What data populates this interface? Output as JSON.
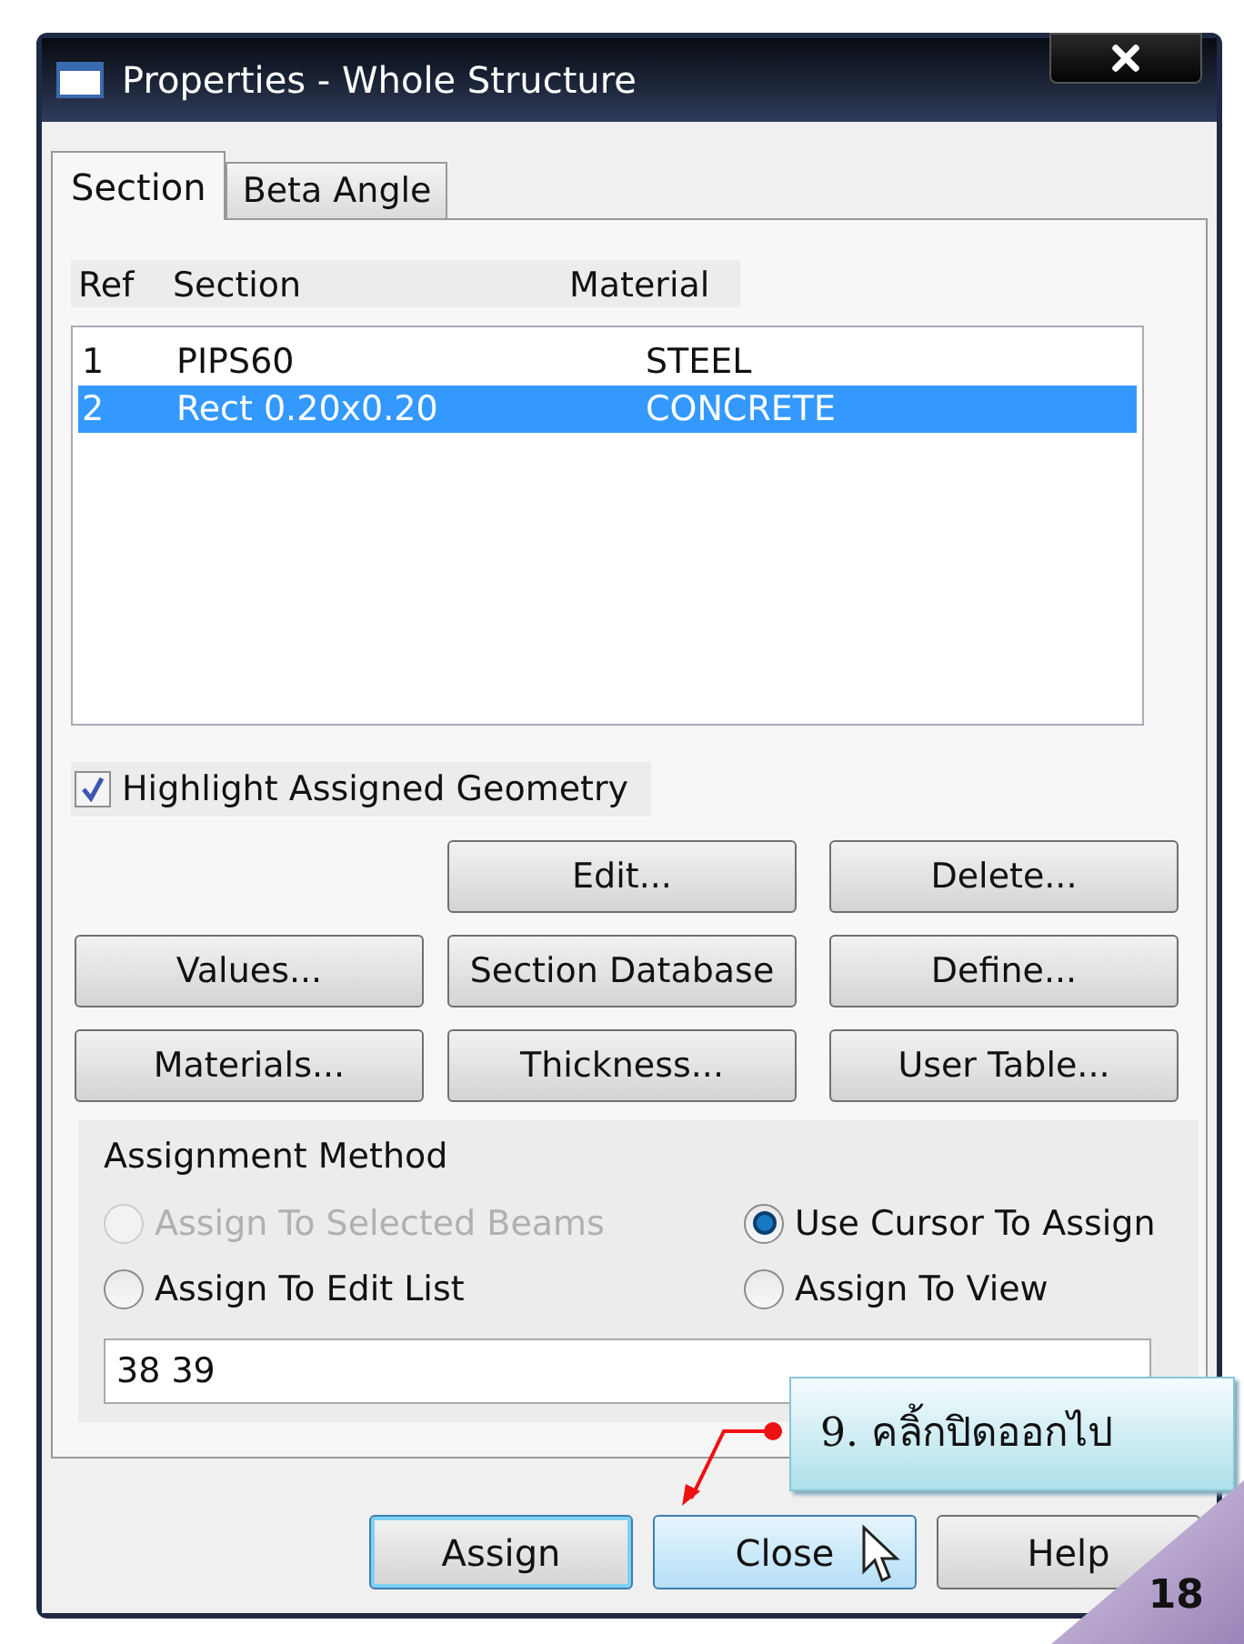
{
  "window": {
    "title": "Properties - Whole Structure"
  },
  "tabs": [
    {
      "label": "Section",
      "selected": true
    },
    {
      "label": "Beta Angle",
      "selected": false
    }
  ],
  "table": {
    "columns": [
      "Ref",
      "Section",
      "Material"
    ],
    "rows": [
      {
        "cells": [
          "1",
          "PIPS60",
          "STEEL"
        ],
        "selected": false
      },
      {
        "cells": [
          "2",
          "Rect 0.20x0.20",
          "CONCRETE"
        ],
        "selected": true
      }
    ]
  },
  "highlight_checkbox": {
    "label": "Highlight Assigned Geometry",
    "checked": true
  },
  "button_rows": [
    [
      "Edit...",
      "Delete..."
    ],
    [
      "Values...",
      "Section Database",
      "Define..."
    ],
    [
      "Materials...",
      "Thickness...",
      "User Table..."
    ]
  ],
  "assignment_method": {
    "title": "Assignment Method",
    "options": [
      {
        "label": "Assign To Selected Beams",
        "selected": false,
        "disabled": true
      },
      {
        "label": "Use Cursor To Assign",
        "selected": true,
        "disabled": false
      },
      {
        "label": "Assign To Edit List",
        "selected": false,
        "disabled": false
      },
      {
        "label": "Assign To View",
        "selected": false,
        "disabled": false
      }
    ],
    "value": "38 39"
  },
  "footer_buttons": [
    {
      "label": "Assign",
      "default": true,
      "hovered": false
    },
    {
      "label": "Close",
      "default": false,
      "hovered": true
    },
    {
      "label": "Help",
      "default": false,
      "hovered": false
    }
  ],
  "callout": {
    "text": "9. คลิ้กปิดออกไป"
  },
  "page_number": "18"
}
